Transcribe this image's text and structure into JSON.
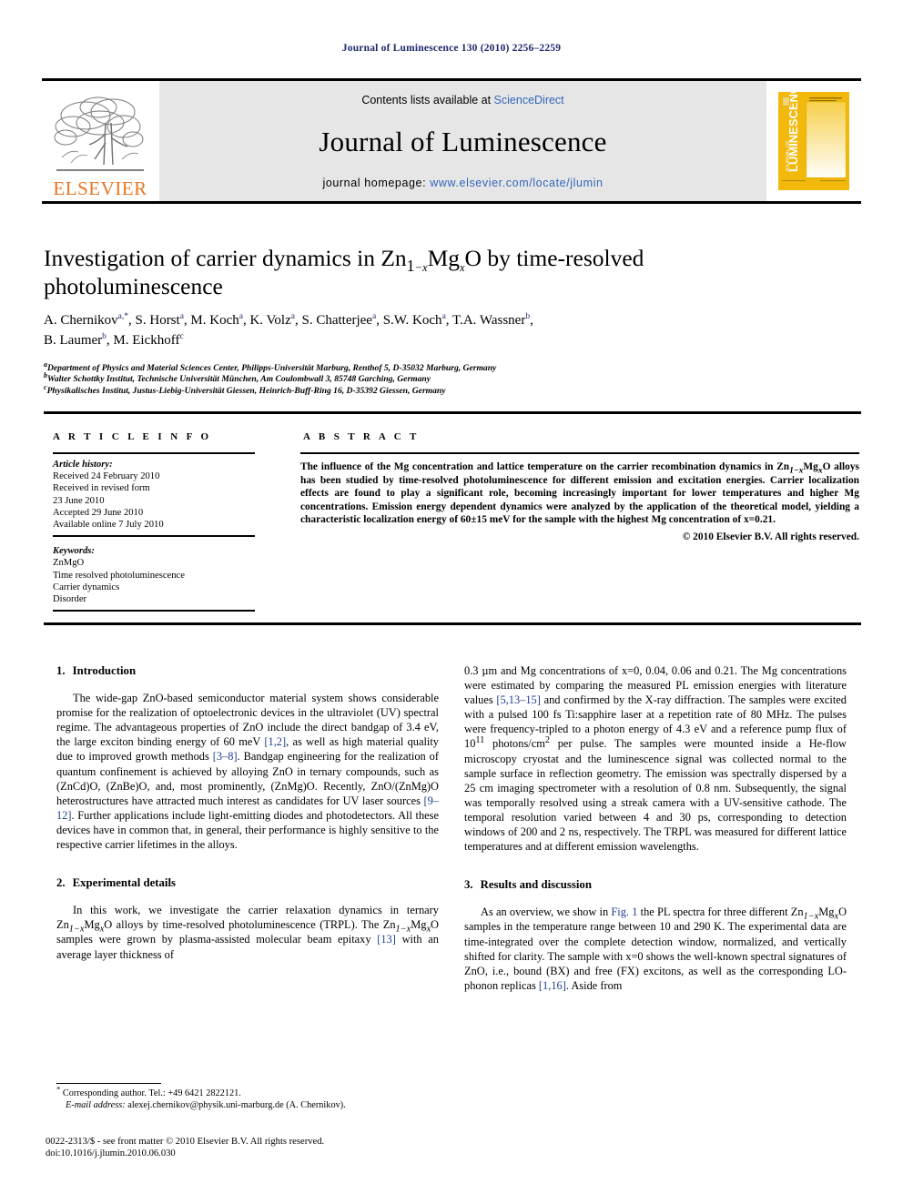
{
  "running_head": "Journal of Luminescence 130 (2010) 2256–2259",
  "masthead": {
    "contents_prefix": "Contents lists available at ",
    "sciencedirect": "ScienceDirect",
    "journal_name": "Journal of Luminescence",
    "homepage_prefix": "journal homepage: ",
    "homepage_url": "www.elsevier.com/locate/jlumin",
    "publisher_wordmark": "ELSEVIER",
    "publisher_color": "#e87722",
    "link_color": "#3366bb",
    "cover_title": "JOURNAL OF LUMINESCENCE",
    "cover_color": "#f2b90c"
  },
  "article": {
    "title_line1_a": "Investigation of carrier dynamics in Zn",
    "title_sub1": "1",
    "title_sub2": "−x",
    "title_mid": "Mg",
    "title_sub3": "x",
    "title_line1_b": "O by time-resolved",
    "title_line2": "photoluminescence",
    "authors": [
      {
        "name": "A. Chernikov",
        "marks": "a,*"
      },
      {
        "name": "S. Horst",
        "marks": "a"
      },
      {
        "name": "M. Koch",
        "marks": "a"
      },
      {
        "name": "K. Volz",
        "marks": "a"
      },
      {
        "name": "S. Chatterjee",
        "marks": "a"
      },
      {
        "name": "S.W. Koch",
        "marks": "a"
      },
      {
        "name": "T.A. Wassner",
        "marks": "b"
      },
      {
        "name": "B. Laumer",
        "marks": "b"
      },
      {
        "name": "M. Eickhoff",
        "marks": "c"
      }
    ],
    "affiliations": [
      {
        "mark": "a",
        "text": "Department of Physics and Material Sciences Center, Philipps-Universität Marburg, Renthof 5, D-35032 Marburg, Germany"
      },
      {
        "mark": "b",
        "text": "Walter Schottky Institut, Technische Universität München, Am Coulombwall 3, 85748 Garching, Germany"
      },
      {
        "mark": "c",
        "text": "Physikalisches Institut, Justus-Liebig-Universität Giessen, Heinrich-Buff-Ring 16, D-35392 Giessen, Germany"
      }
    ]
  },
  "labels": {
    "article_info": "A R T I C L E   I N F O",
    "abstract": "A B S T R A C T"
  },
  "article_info": {
    "history_heading": "Article history:",
    "history_lines": [
      "Received 24 February 2010",
      "Received in revised form",
      "23 June 2010",
      "Accepted 29 June 2010",
      "Available online 7 July 2010"
    ],
    "keywords_heading": "Keywords:",
    "keywords": [
      "ZnMgO",
      "Time resolved photoluminescence",
      "Carrier dynamics",
      "Disorder"
    ]
  },
  "abstract": {
    "text_a": "The influence of the Mg concentration and lattice temperature on the carrier recombination dynamics in Zn",
    "sub_a": "1−x",
    "text_b": "Mg",
    "sub_b": "x",
    "text_c": "O alloys has been studied by time-resolved photoluminescence for different emission and excitation energies. Carrier localization effects are found to play a significant role, becoming increasingly important for lower temperatures and higher Mg concentrations. Emission energy dependent dynamics were analyzed by the application of the theoretical model, yielding a characteristic localization energy of 60±15 meV for the sample with the highest Mg concentration of x=0.21.",
    "copyright": "© 2010 Elsevier B.V. All rights reserved."
  },
  "sections": {
    "introduction": {
      "number": "1.",
      "title": "Introduction",
      "para_a": "The wide-gap ZnO-based semiconductor material system shows considerable promise for the realization of optoelectronic devices in the ultraviolet (UV) spectral regime. The advantageous properties of ZnO include the direct bandgap of 3.4 eV, the large exciton binding energy of 60 meV ",
      "ref_1": "[1,2]",
      "para_b": ", as well as high material quality due to improved growth methods ",
      "ref_2": "[3–8]",
      "para_c": ". Bandgap engineering for the realization of quantum confinement is achieved by alloying ZnO in ternary compounds, such as (ZnCd)O, (ZnBe)O, and, most prominently, (ZnMg)O. Recently, ZnO/(ZnMg)O heterostructures have attracted much interest as candidates for UV laser sources ",
      "ref_3": "[9–12]",
      "para_d": ". Further applications include light-emitting diodes and photodetectors. All these devices have in common that, in general, their performance is highly sensitive to the respective carrier lifetimes in the alloys."
    },
    "experimental": {
      "number": "2.",
      "title": "Experimental details",
      "para_a": "In this work, we investigate the carrier relaxation dynamics in ternary Zn",
      "sub_a": "1−x",
      "para_b": "Mg",
      "sub_b": "x",
      "para_c": "O alloys by time-resolved photoluminescence (TRPL). The Zn",
      "para_d": "O samples were grown by plasma-assisted molecular beam epitaxy ",
      "ref_1": "[13]",
      "para_e": " with an average layer thickness of"
    },
    "experimental_cont": {
      "text_a": "0.3 µm and Mg concentrations of x=0, 0.04, 0.06 and 0.21. The Mg concentrations were estimated by comparing the measured PL emission energies with literature values ",
      "ref_1": "[5,13–15]",
      "text_b": " and confirmed by the X-ray diffraction. The samples were excited with a pulsed 100 fs Ti:sapphire laser at a repetition rate of 80 MHz. The pulses were frequency-tripled to a photon energy of 4.3 eV and a reference pump flux of 10",
      "sup_a": "11",
      "text_c": " photons/cm",
      "sup_b": "2",
      "text_d": " per pulse. The samples were mounted inside a He-flow microscopy cryostat and the luminescence signal was collected normal to the sample surface in reflection geometry. The emission was spectrally dispersed by a 25 cm imaging spectrometer with a resolution of 0.8 nm. Subsequently, the signal was temporally resolved using a streak camera with a UV-sensitive cathode. The temporal resolution varied between 4 and 30 ps, corresponding to detection windows of 200 and 2 ns, respectively. The TRPL was measured for different lattice temperatures and at different emission wavelengths."
    },
    "results": {
      "number": "3.",
      "title": "Results and discussion",
      "para_a": "As an overview, we show in ",
      "fig_ref": "Fig. 1",
      "para_b": " the PL spectra for three different Zn",
      "sub_a": "1−x",
      "para_c": "Mg",
      "sub_b": "x",
      "para_d": "O samples in the temperature range between 10 and 290 K. The experimental data are time-integrated over the complete detection window, normalized, and vertically shifted for clarity. The sample with x=0 shows the well-known spectral signatures of ZnO, i.e., bound (BX) and free (FX) excitons, as well as the corresponding LO-phonon replicas ",
      "ref_1": "[1,16]",
      "para_e": ". Aside from"
    }
  },
  "footnote": {
    "star": "*",
    "corresponding": " Corresponding author. Tel.: +49 6421 2822121.",
    "email_label": "E-mail address:",
    "email": " alexej.chernikov@physik.uni-marburg.de (A. Chernikov)."
  },
  "imprint": {
    "line1": "0022-2313/$ - see front matter © 2010 Elsevier B.V. All rights reserved.",
    "line2": "doi:10.1016/j.jlumin.2010.06.030"
  }
}
